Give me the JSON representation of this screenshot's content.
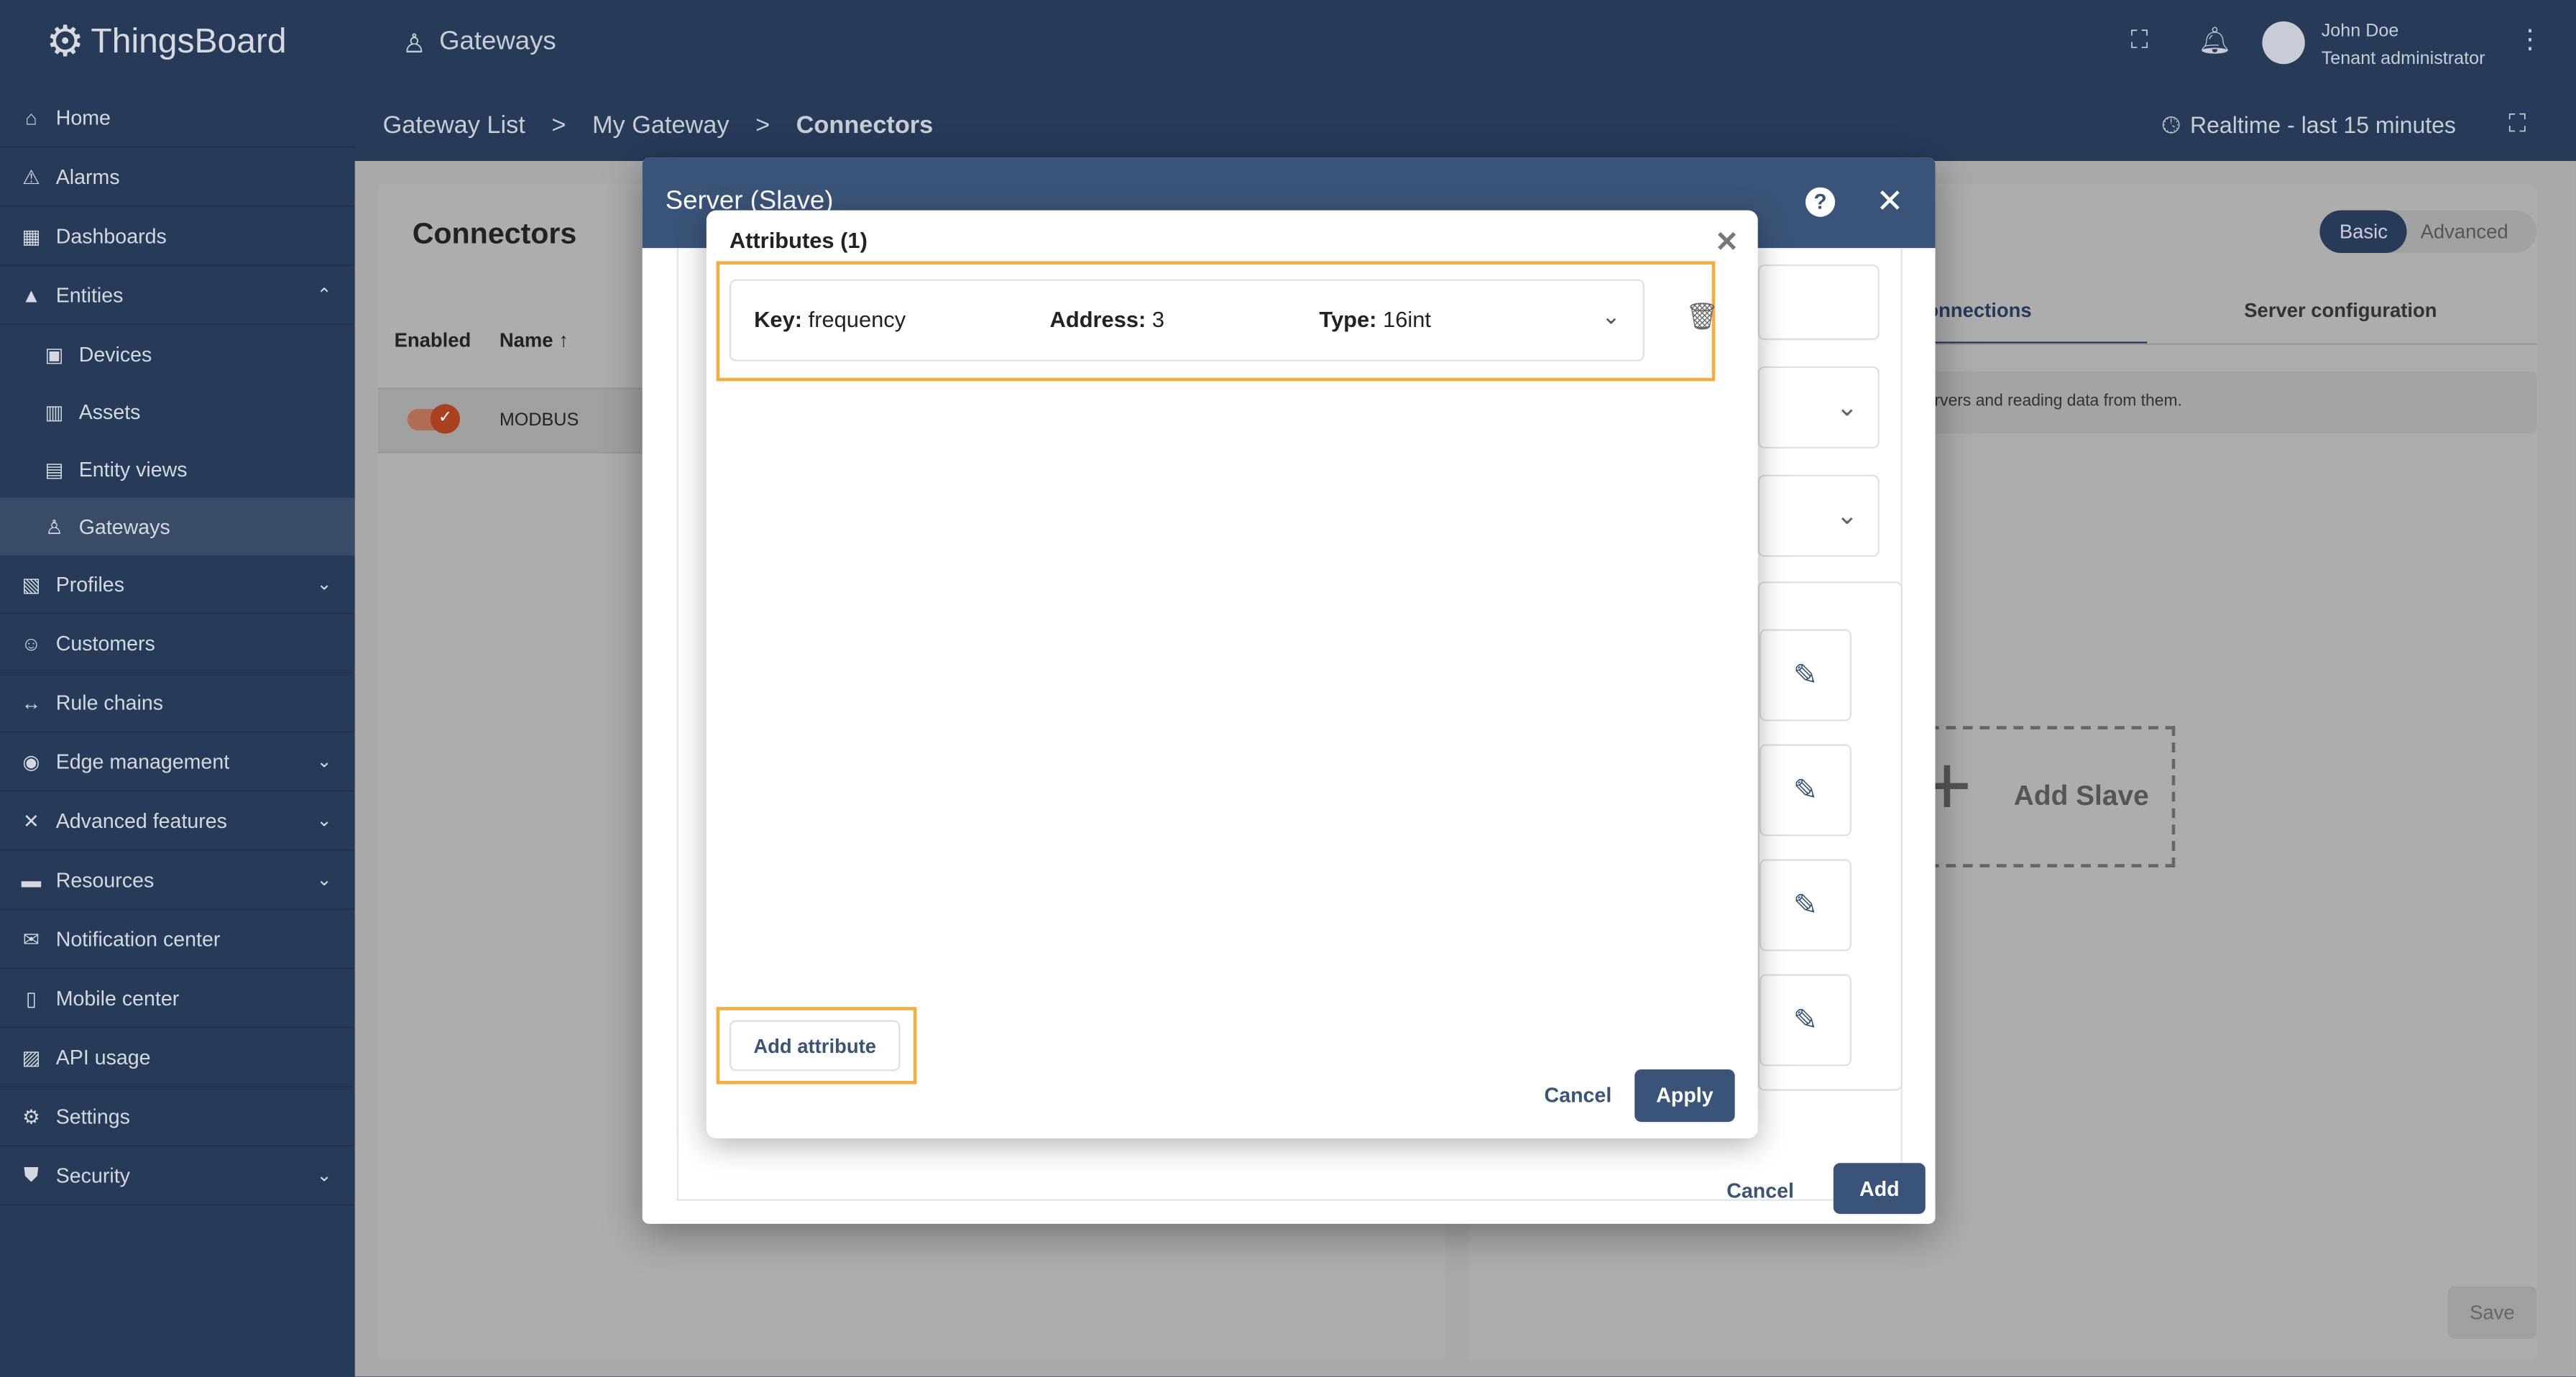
{
  "app": {
    "name": "ThingsBoard",
    "section": "Gateways"
  },
  "header": {
    "user_name": "John Doe",
    "user_role": "Tenant administrator",
    "timewindow": "Realtime - last 15 minutes"
  },
  "breadcrumb": [
    "Gateway List",
    ">",
    "My Gateway",
    ">",
    "Connectors"
  ],
  "sidebar": {
    "items": [
      {
        "label": "Home",
        "icon": "⌂"
      },
      {
        "label": "Alarms",
        "icon": "⚠"
      },
      {
        "label": "Dashboards",
        "icon": "▦"
      },
      {
        "label": "Entities",
        "icon": "▲",
        "chev": "⌃"
      },
      {
        "label": "Devices",
        "icon": "▣",
        "sub": true
      },
      {
        "label": "Assets",
        "icon": "▥",
        "sub": true
      },
      {
        "label": "Entity views",
        "icon": "▤",
        "sub": true
      },
      {
        "label": "Gateways",
        "icon": "♙",
        "sub": true,
        "active": true
      },
      {
        "label": "Profiles",
        "icon": "▧",
        "chev": "⌄"
      },
      {
        "label": "Customers",
        "icon": "☺"
      },
      {
        "label": "Rule chains",
        "icon": "↔"
      },
      {
        "label": "Edge management",
        "icon": "◉",
        "chev": "⌄"
      },
      {
        "label": "Advanced features",
        "icon": "✕",
        "chev": "⌄"
      },
      {
        "label": "Resources",
        "icon": "▬",
        "chev": "⌄"
      },
      {
        "label": "Notification center",
        "icon": "✉"
      },
      {
        "label": "Mobile center",
        "icon": "▯"
      },
      {
        "label": "API usage",
        "icon": "▨"
      },
      {
        "label": "Settings",
        "icon": "⚙"
      },
      {
        "label": "Security",
        "icon": "⛊",
        "chev": "⌄"
      }
    ]
  },
  "connectors": {
    "title": "Connectors",
    "col_enabled": "Enabled",
    "col_name": "Name",
    "sort_icon": "↑",
    "rows": [
      {
        "name": "MODBUS",
        "enabled": true
      }
    ]
  },
  "right_panel": {
    "mode_basic": "Basic",
    "mode_advanced": "Advanced",
    "tab_connections": "Connections",
    "tab_server": "Server configuration",
    "info": "ervers and reading data from them.",
    "add_slave": "Add Slave",
    "save": "Save"
  },
  "dialog": {
    "title": "Server (Slave)",
    "cancel": "Cancel",
    "add": "Add"
  },
  "attributes": {
    "title": "Attributes (1)",
    "key_label": "Key:",
    "key": "frequency",
    "address_label": "Address:",
    "address": "3",
    "type_label": "Type:",
    "type": "16int",
    "add_button": "Add attribute",
    "cancel": "Cancel",
    "apply": "Apply"
  }
}
